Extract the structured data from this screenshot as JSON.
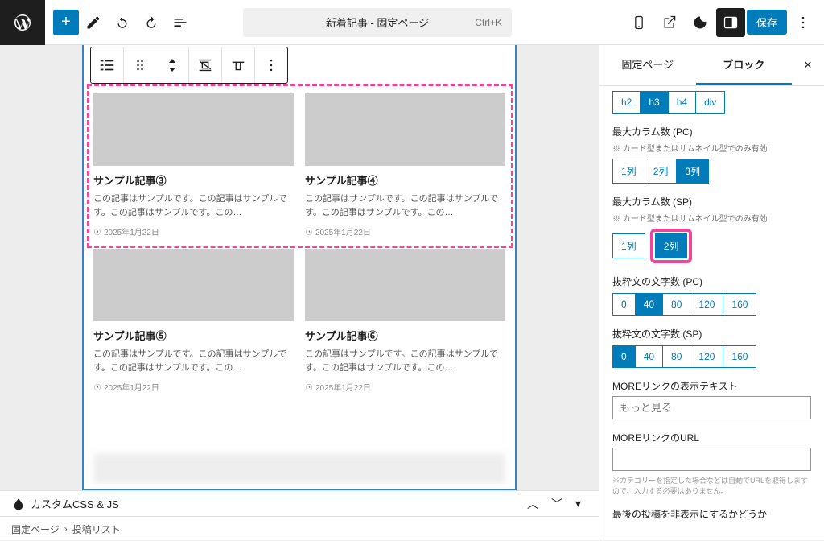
{
  "topbar": {
    "page_title": "新着記事 - 固定ページ",
    "shortcut": "Ctrl+K",
    "save_label": "保存"
  },
  "articles": [
    {
      "title": "サンプル記事③",
      "excerpt": "この記事はサンプルです。この記事はサンプルです。この記事はサンプルです。この…",
      "date": "2025年1月22日"
    },
    {
      "title": "サンプル記事④",
      "excerpt": "この記事はサンプルです。この記事はサンプルです。この記事はサンプルです。この…",
      "date": "2025年1月22日"
    },
    {
      "title": "サンプル記事⑤",
      "excerpt": "この記事はサンプルです。この記事はサンプルです。この記事はサンプルです。この…",
      "date": "2025年1月22日"
    },
    {
      "title": "サンプル記事⑥",
      "excerpt": "この記事はサンプルです。この記事はサンプルです。この記事はサンプルです。この…",
      "date": "2025年1月22日"
    }
  ],
  "panel": {
    "tabs": {
      "page": "固定ページ",
      "block": "ブロック"
    },
    "heading_opts": [
      "h2",
      "h3",
      "h4",
      "div"
    ],
    "heading_active": "h3",
    "max_col_pc_label": "最大カラム数 (PC)",
    "col_note": "※ カード型またはサムネイル型でのみ有効",
    "col_pc_opts": [
      "1列",
      "2列",
      "3列"
    ],
    "col_pc_active": "3列",
    "max_col_sp_label": "最大カラム数 (SP)",
    "col_sp_opts": [
      "1列",
      "2列"
    ],
    "col_sp_active": "2列",
    "excerpt_pc_label": "抜粋文の文字数 (PC)",
    "count_opts": [
      "0",
      "40",
      "80",
      "120",
      "160"
    ],
    "excerpt_pc_active": "40",
    "excerpt_sp_label": "抜粋文の文字数 (SP)",
    "excerpt_sp_active": "0",
    "more_text_label": "MOREリンクの表示テキスト",
    "more_text_placeholder": "もっと見る",
    "more_url_label": "MOREリンクのURL",
    "more_url_note": "※カテゴリーを指定した場合などは自動でURLを取得しますので、入力する必要はありません。",
    "hide_last_label": "最後の投稿を非表示にするかどうか"
  },
  "breadcrumb": {
    "theme_label": "カスタムCSS & JS",
    "path1": "固定ページ",
    "path2": "投稿リスト"
  }
}
